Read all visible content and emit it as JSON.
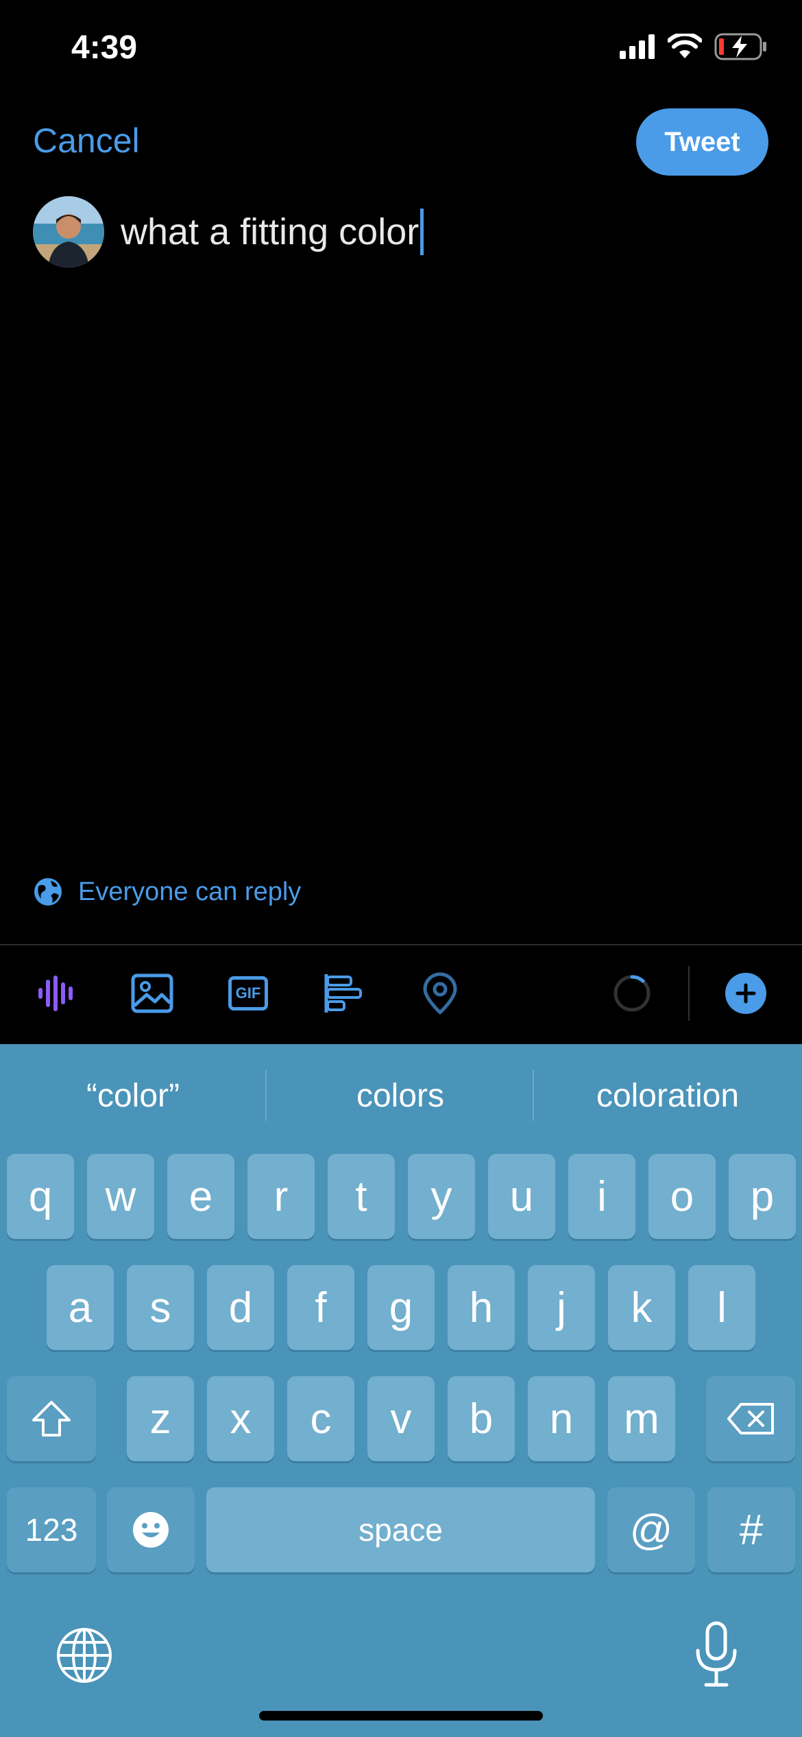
{
  "status": {
    "time": "4:39"
  },
  "header": {
    "cancel_label": "Cancel",
    "tweet_label": "Tweet"
  },
  "compose": {
    "text": "what a fitting color"
  },
  "reply": {
    "label": "Everyone can reply"
  },
  "colors": {
    "accent": "#4A9BE8",
    "keyboard_bg": "#4A93B9",
    "key_bg": "#73AFCE",
    "voice_purple": "#8B5CF6"
  },
  "toolbar": {
    "icons": [
      "voice-icon",
      "image-icon",
      "gif-icon",
      "poll-icon",
      "location-icon",
      "progress-ring-icon",
      "add-thread-icon"
    ],
    "gif_label": "GIF"
  },
  "keyboard": {
    "suggestions": [
      "“color”",
      "colors",
      "coloration"
    ],
    "row1": [
      "q",
      "w",
      "e",
      "r",
      "t",
      "y",
      "u",
      "i",
      "o",
      "p"
    ],
    "row2": [
      "a",
      "s",
      "d",
      "f",
      "g",
      "h",
      "j",
      "k",
      "l"
    ],
    "row3": [
      "z",
      "x",
      "c",
      "v",
      "b",
      "n",
      "m"
    ],
    "numbers_label": "123",
    "space_label": "space",
    "at_label": "@",
    "hash_label": "#"
  }
}
